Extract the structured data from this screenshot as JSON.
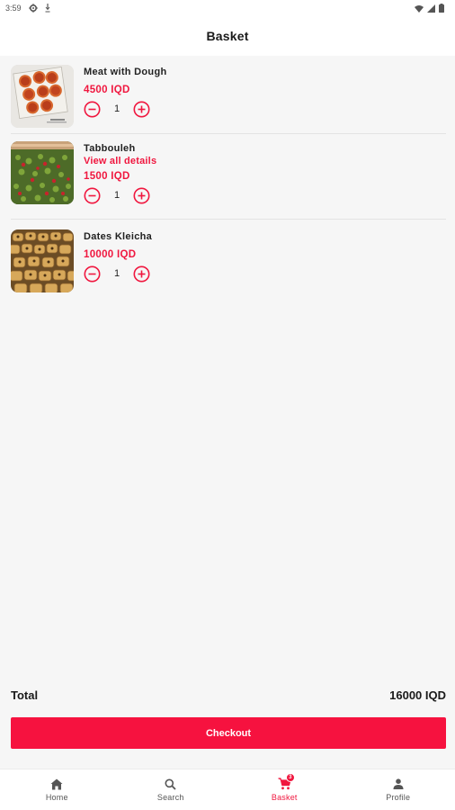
{
  "status_bar": {
    "time": "3:59"
  },
  "header": {
    "title": "Basket"
  },
  "items": [
    {
      "name": "Meat with Dough",
      "link": "",
      "price": "4500 IQD",
      "quantity": "1",
      "image": "meat-dough-photo"
    },
    {
      "name": "Tabbouleh",
      "link": "View all details",
      "price": "1500 IQD",
      "quantity": "1",
      "image": "tabbouleh-photo"
    },
    {
      "name": "Dates Kleicha",
      "link": "",
      "price": "10000 IQD",
      "quantity": "1",
      "image": "dates-kleicha-photo"
    }
  ],
  "summary": {
    "total_label": "Total",
    "total_value": "16000 IQD"
  },
  "checkout": {
    "label": "Checkout"
  },
  "nav": {
    "home": "Home",
    "search": "Search",
    "basket": "Basket",
    "basket_badge": "3",
    "profile": "Profile"
  },
  "colors": {
    "accent": "#f0173f",
    "button": "#f6123f",
    "background": "#f6f6f6"
  }
}
